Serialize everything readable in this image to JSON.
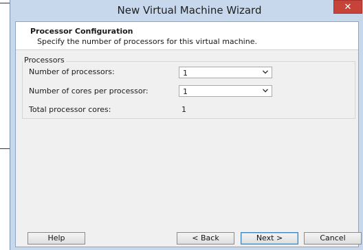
{
  "window": {
    "title": "New Virtual Machine Wizard",
    "close_glyph": "✕"
  },
  "header": {
    "title": "Processor Configuration",
    "subtitle": "Specify the number of processors for this virtual machine."
  },
  "processors": {
    "group_label": "Processors",
    "num_processors_label": "Number of processors:",
    "num_processors_value": "1",
    "cores_label": "Number of cores per processor:",
    "cores_value": "1",
    "total_label": "Total processor cores:",
    "total_value": "1"
  },
  "buttons": {
    "help": "Help",
    "back": "< Back",
    "next": "Next >",
    "cancel": "Cancel"
  },
  "icons": {
    "dropdown": "chevron-down-icon",
    "close": "close-icon"
  },
  "colors": {
    "close_button": "#c7433a",
    "window_frame": "#c7d8ec",
    "default_button_border": "#3c7fb1"
  }
}
